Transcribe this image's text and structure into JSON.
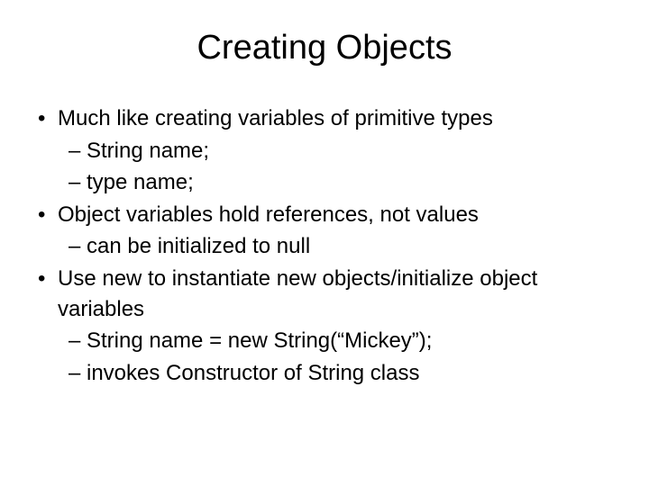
{
  "title": "Creating Objects",
  "bullets": {
    "b1": "Much like creating variables of primitive types",
    "b1_1": "String name;",
    "b1_2": "type name;",
    "b2": "Object variables hold references, not values",
    "b2_1": "can be initialized to null",
    "b3": "Use new to instantiate new objects/initialize object variables",
    "b3_1": "String name = new String(“Mickey”);",
    "b3_2": "invokes Constructor of String class"
  }
}
